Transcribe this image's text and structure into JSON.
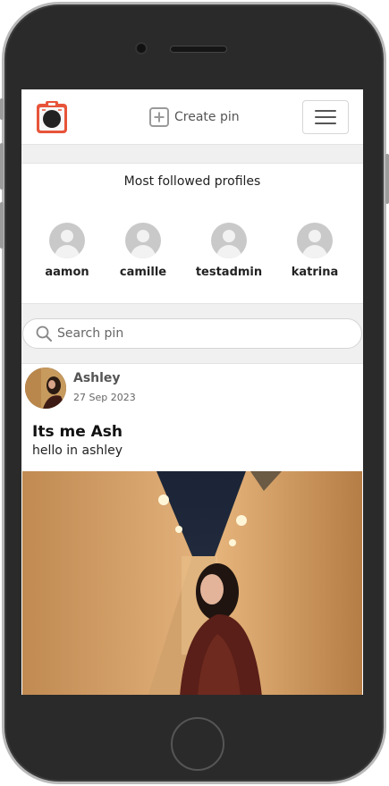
{
  "header": {
    "logo_icon": "pinterest-clipboard-logo",
    "create_pin_label": "Create pin",
    "menu_icon": "hamburger-menu-icon"
  },
  "profiles": {
    "title": "Most followed profiles",
    "items": [
      {
        "username": "aamon"
      },
      {
        "username": "camille"
      },
      {
        "username": "testadmin"
      },
      {
        "username": "katrina"
      }
    ]
  },
  "search": {
    "placeholder": "Search pin",
    "value": ""
  },
  "post": {
    "author": "Ashley",
    "date": "27 Sep 2023",
    "title": "Its me Ash",
    "body": "hello in ashley"
  },
  "colors": {
    "logo_accent": "#e8543a",
    "avatar_placeholder": "#c9c9c9",
    "device_frame": "#2a2a2a"
  }
}
